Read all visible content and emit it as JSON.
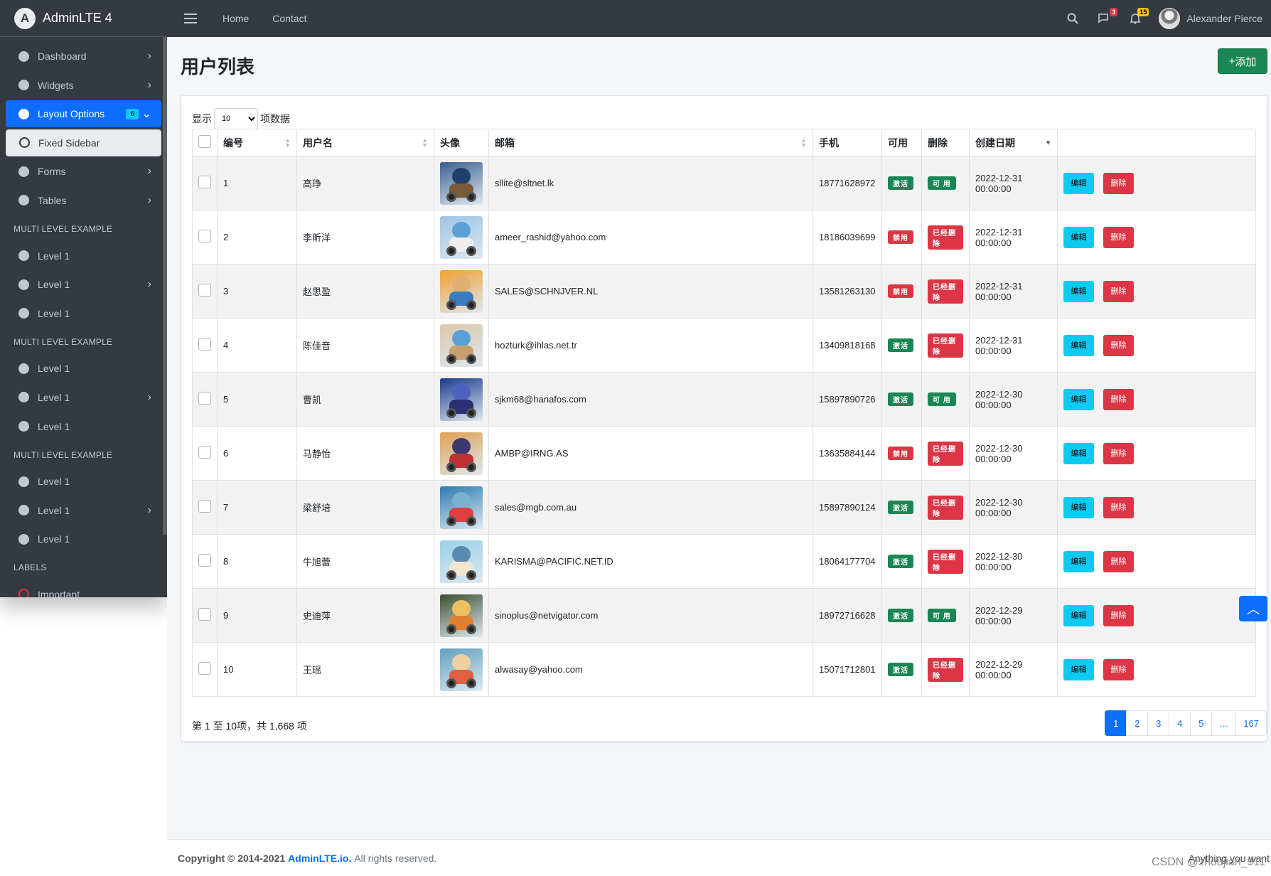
{
  "brand": {
    "name": "AdminLTE 4",
    "logo_letter": "A"
  },
  "sidebar": {
    "items": [
      {
        "label": "Dashboard"
      },
      {
        "label": "Widgets"
      },
      {
        "label": "Layout Options",
        "badge": "6"
      },
      {
        "label": "Fixed Sidebar"
      },
      {
        "label": "Forms"
      },
      {
        "label": "Tables"
      }
    ],
    "sections": [
      {
        "header": "MULTI LEVEL EXAMPLE",
        "items": [
          "Level 1",
          "Level 1",
          "Level 1"
        ]
      },
      {
        "header": "MULTI LEVEL EXAMPLE",
        "items": [
          "Level 1",
          "Level 1",
          "Level 1"
        ]
      },
      {
        "header": "MULTI LEVEL EXAMPLE",
        "items": [
          "Level 1",
          "Level 1",
          "Level 1"
        ]
      }
    ],
    "labels_header": "LABELS",
    "important": "Important"
  },
  "topbar": {
    "home": "Home",
    "contact": "Contact",
    "messages_count": "3",
    "notifications_count": "15",
    "user_name": "Alexander Pierce"
  },
  "page": {
    "title": "用户列表",
    "add_label": "添加"
  },
  "length": {
    "prefix": "显示",
    "value": "10",
    "suffix": "项数据"
  },
  "table": {
    "headers": [
      "编号",
      "用户名",
      "头像",
      "邮箱",
      "手机",
      "可用",
      "删除",
      "创建日期"
    ],
    "edit_label": "编辑",
    "delete_label": "删除",
    "rows": [
      {
        "id": "1",
        "name": "高琤",
        "email": "sllite@sltnet.lk",
        "phone": "18771628972",
        "enabled": "激活",
        "deleted": "可 用",
        "created": "2022-12-31 00:00:00"
      },
      {
        "id": "2",
        "name": "李昕洋",
        "email": "ameer_rashid@yahoo.com",
        "phone": "18186039699",
        "enabled": "禁用",
        "deleted": "已经删除",
        "created": "2022-12-31 00:00:00"
      },
      {
        "id": "3",
        "name": "赵思盈",
        "email": "SALES@SCHNJVER.NL",
        "phone": "13581263130",
        "enabled": "禁用",
        "deleted": "已经删除",
        "created": "2022-12-31 00:00:00"
      },
      {
        "id": "4",
        "name": "陈佳音",
        "email": "hozturk@ihlas.net.tr",
        "phone": "13409818168",
        "enabled": "激活",
        "deleted": "已经删除",
        "created": "2022-12-31 00:00:00"
      },
      {
        "id": "5",
        "name": "曹凯",
        "email": "sjkm68@hanafos.com",
        "phone": "15897890726",
        "enabled": "激活",
        "deleted": "可 用",
        "created": "2022-12-30 00:00:00"
      },
      {
        "id": "6",
        "name": "马静怡",
        "email": "AMBP@IRNG.AS",
        "phone": "13635884144",
        "enabled": "禁用",
        "deleted": "已经删除",
        "created": "2022-12-30 00:00:00"
      },
      {
        "id": "7",
        "name": "梁舒培",
        "email": "sales@mgb.com.au",
        "phone": "15897890124",
        "enabled": "激活",
        "deleted": "已经删除",
        "created": "2022-12-30 00:00:00"
      },
      {
        "id": "8",
        "name": "牛旭蕾",
        "email": "KARISMA@PACIFIC.NET.ID",
        "phone": "18064177704",
        "enabled": "激活",
        "deleted": "已经删除",
        "created": "2022-12-30 00:00:00"
      },
      {
        "id": "9",
        "name": "史迪萍",
        "email": "sinoplus@netvigator.com",
        "phone": "18972716628",
        "enabled": "激活",
        "deleted": "可 用",
        "created": "2022-12-29 00:00:00"
      },
      {
        "id": "10",
        "name": "王瑶",
        "email": "alwasay@yahoo.com",
        "phone": "15071712801",
        "enabled": "激活",
        "deleted": "已经删除",
        "created": "2022-12-29 00:00:00"
      }
    ]
  },
  "info": "第 1 至 10项，共 1,668 项",
  "pagination": [
    "1",
    "2",
    "3",
    "4",
    "5",
    "…",
    "167"
  ],
  "footer": {
    "copyright": "Copyright © 2014-2021",
    "link": "AdminLTE.io.",
    "rights": "All rights reserved.",
    "right_text": "Anything you want"
  },
  "watermark": "CSDN @zhoujian_911",
  "colors": {
    "primary": "#0d6efd",
    "success": "#198754",
    "danger": "#dc3545",
    "info": "#0dcaf0",
    "sidebar": "#343a40"
  }
}
